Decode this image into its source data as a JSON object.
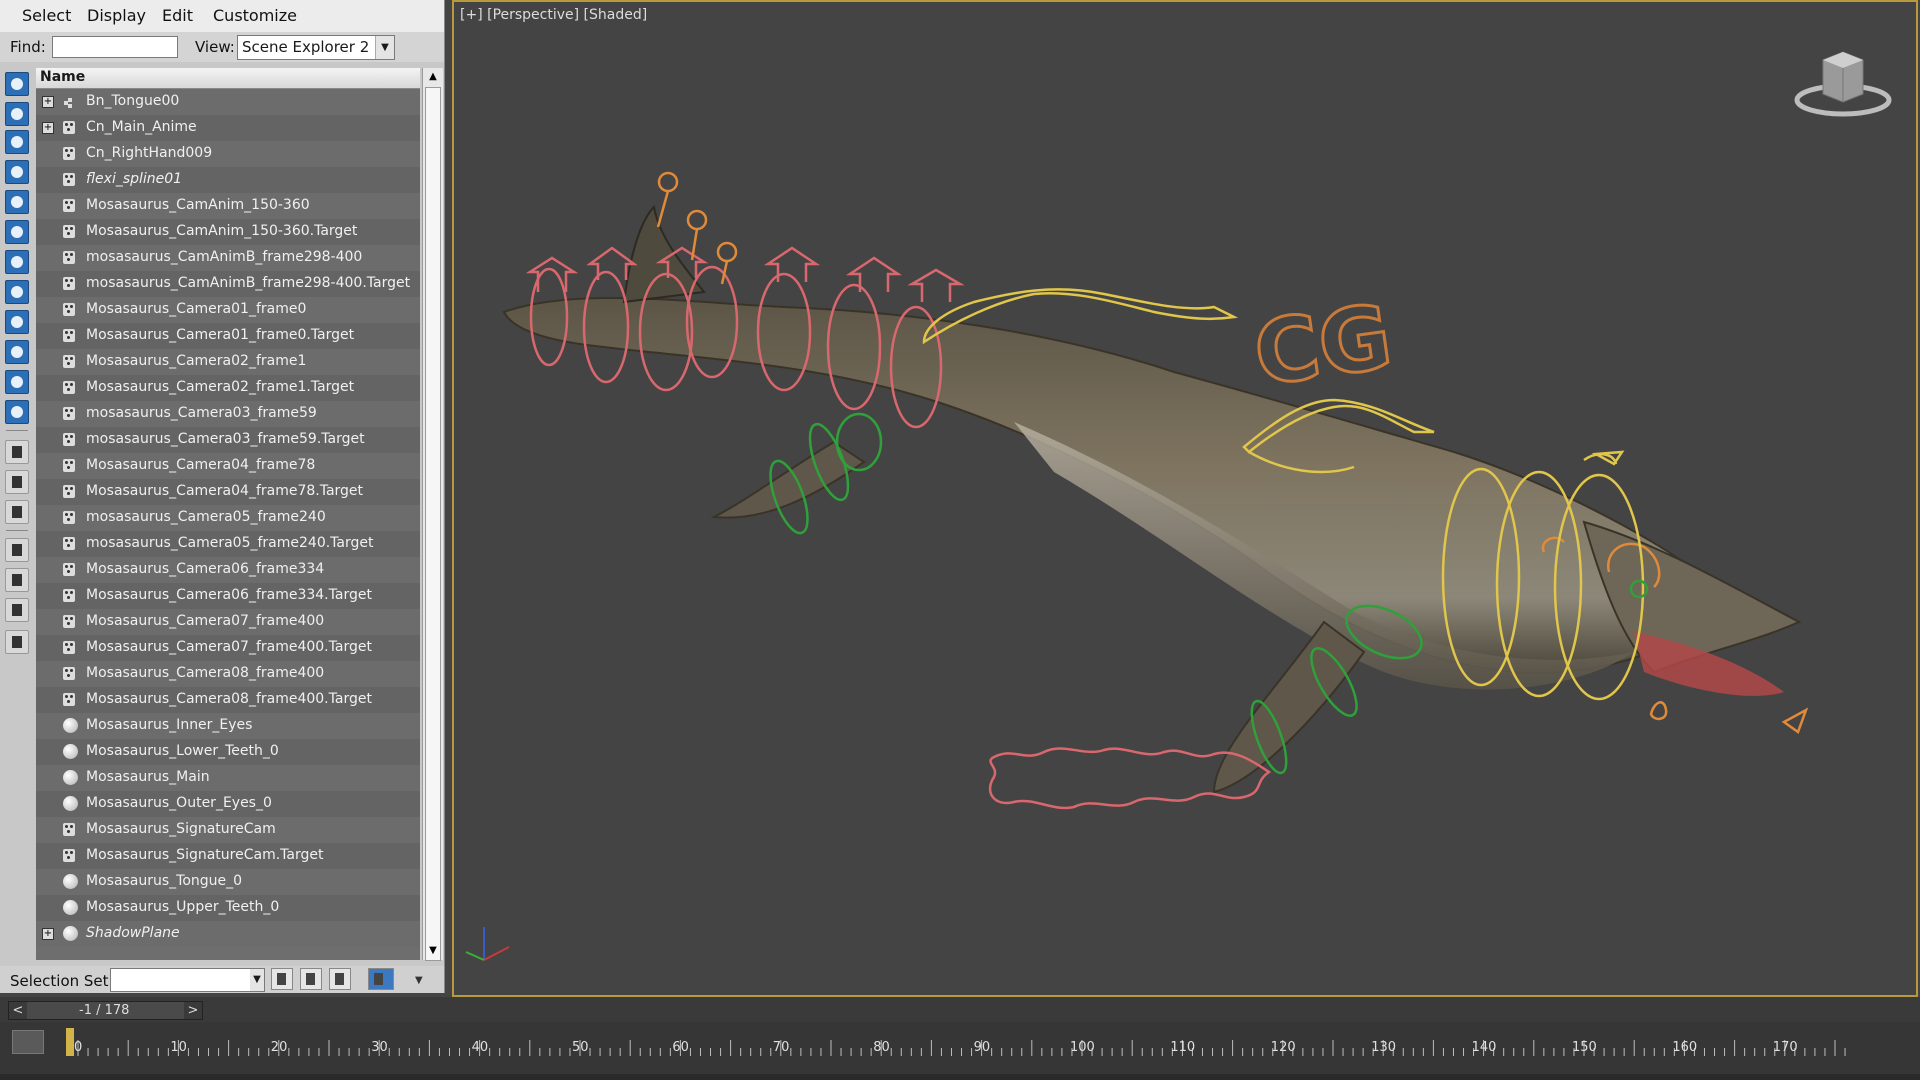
{
  "menu": [
    "Select",
    "Display",
    "Edit",
    "Customize"
  ],
  "find": {
    "label": "Find:",
    "value": ""
  },
  "view": {
    "label": "View:",
    "value": "Scene Explorer 2"
  },
  "list_header": "Name",
  "rows": [
    {
      "name": "Bn_Tongue00",
      "icon": "dots",
      "expand": true,
      "italic": false
    },
    {
      "name": "Cn_Main_Anime",
      "icon": "cam",
      "expand": true,
      "italic": false
    },
    {
      "name": "Cn_RightHand009",
      "icon": "cam",
      "expand": false,
      "italic": false
    },
    {
      "name": "flexi_spline01",
      "icon": "cam",
      "expand": false,
      "italic": true
    },
    {
      "name": "Mosasaurus_CamAnim_150-360",
      "icon": "cam",
      "expand": false,
      "italic": false
    },
    {
      "name": "Mosasaurus_CamAnim_150-360.Target",
      "icon": "cam",
      "expand": false,
      "italic": false
    },
    {
      "name": "mosasaurus_CamAnimB_frame298-400",
      "icon": "cam",
      "expand": false,
      "italic": false
    },
    {
      "name": "mosasaurus_CamAnimB_frame298-400.Target",
      "icon": "cam",
      "expand": false,
      "italic": false
    },
    {
      "name": "Mosasaurus_Camera01_frame0",
      "icon": "cam",
      "expand": false,
      "italic": false
    },
    {
      "name": "Mosasaurus_Camera01_frame0.Target",
      "icon": "cam",
      "expand": false,
      "italic": false
    },
    {
      "name": "Mosasaurus_Camera02_frame1",
      "icon": "cam",
      "expand": false,
      "italic": false
    },
    {
      "name": "Mosasaurus_Camera02_frame1.Target",
      "icon": "cam",
      "expand": false,
      "italic": false
    },
    {
      "name": "mosasaurus_Camera03_frame59",
      "icon": "cam",
      "expand": false,
      "italic": false
    },
    {
      "name": "mosasaurus_Camera03_frame59.Target",
      "icon": "cam",
      "expand": false,
      "italic": false
    },
    {
      "name": "Mosasaurus_Camera04_frame78",
      "icon": "cam",
      "expand": false,
      "italic": false
    },
    {
      "name": "Mosasaurus_Camera04_frame78.Target",
      "icon": "cam",
      "expand": false,
      "italic": false
    },
    {
      "name": "mosasaurus_Camera05_frame240",
      "icon": "cam",
      "expand": false,
      "italic": false
    },
    {
      "name": "mosasaurus_Camera05_frame240.Target",
      "icon": "cam",
      "expand": false,
      "italic": false
    },
    {
      "name": "Mosasaurus_Camera06_frame334",
      "icon": "cam",
      "expand": false,
      "italic": false
    },
    {
      "name": "Mosasaurus_Camera06_frame334.Target",
      "icon": "cam",
      "expand": false,
      "italic": false
    },
    {
      "name": "Mosasaurus_Camera07_frame400",
      "icon": "cam",
      "expand": false,
      "italic": false
    },
    {
      "name": "Mosasaurus_Camera07_frame400.Target",
      "icon": "cam",
      "expand": false,
      "italic": false
    },
    {
      "name": "Mosasaurus_Camera08_frame400",
      "icon": "cam",
      "expand": false,
      "italic": false
    },
    {
      "name": "Mosasaurus_Camera08_frame400.Target",
      "icon": "cam",
      "expand": false,
      "italic": false
    },
    {
      "name": "Mosasaurus_Inner_Eyes",
      "icon": "sphere",
      "expand": false,
      "italic": false
    },
    {
      "name": "Mosasaurus_Lower_Teeth_0",
      "icon": "sphere",
      "expand": false,
      "italic": false
    },
    {
      "name": "Mosasaurus_Main",
      "icon": "sphere",
      "expand": false,
      "italic": false
    },
    {
      "name": "Mosasaurus_Outer_Eyes_0",
      "icon": "sphere",
      "expand": false,
      "italic": false
    },
    {
      "name": "Mosasaurus_SignatureCam",
      "icon": "cam",
      "expand": false,
      "italic": false
    },
    {
      "name": "Mosasaurus_SignatureCam.Target",
      "icon": "cam",
      "expand": false,
      "italic": false
    },
    {
      "name": "Mosasaurus_Tongue_0",
      "icon": "sphere",
      "expand": false,
      "italic": false
    },
    {
      "name": "Mosasaurus_Upper_Teeth_0",
      "icon": "sphere",
      "expand": false,
      "italic": false
    },
    {
      "name": "ShadowPlane",
      "icon": "sphere",
      "expand": true,
      "italic": true
    }
  ],
  "selection_set": {
    "label": "Selection Set:",
    "value": ""
  },
  "viewport": {
    "label": "[+] [Perspective] [Shaded]",
    "logo_text": "CG"
  },
  "time": {
    "current": "-1 / 178",
    "prev": "<",
    "next": ">"
  },
  "ruler_ticks": [
    "0",
    "10",
    "20",
    "30",
    "40",
    "50",
    "60",
    "70",
    "80",
    "90",
    "100",
    "110",
    "120",
    "130",
    "140",
    "150",
    "160",
    "170"
  ],
  "colors": {
    "rig_pink": "#d9686e",
    "rig_yellow": "#e0c64a",
    "rig_green": "#2fa03a",
    "rig_orange": "#e08a3a",
    "viewport_border": "#b89a3a"
  }
}
